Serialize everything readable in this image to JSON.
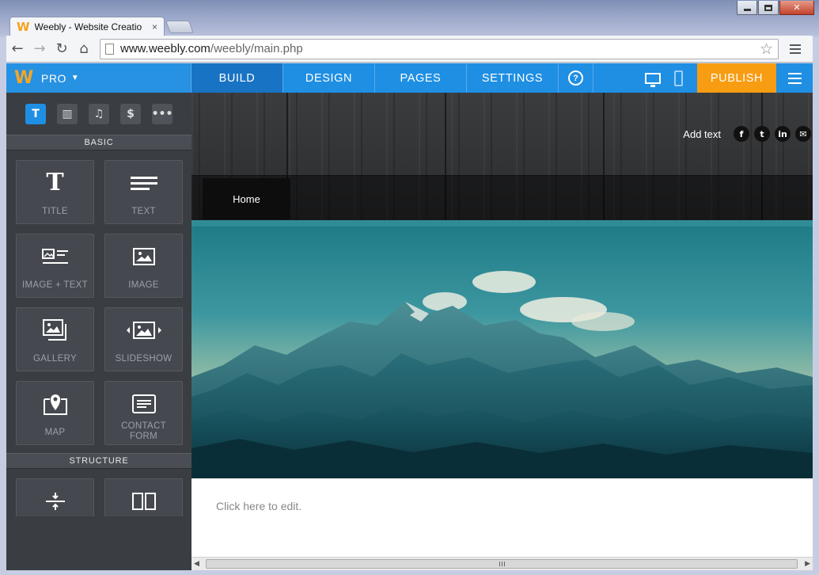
{
  "browser": {
    "tab_title": "Weebly - Website Creatio",
    "tab_favicon": "W",
    "tab_close": "×",
    "url_host": "www.weebly.com",
    "url_path": "/weebly/main.php"
  },
  "app": {
    "brand_logo": "W",
    "brand_label": "PRO",
    "tabs": [
      {
        "label": "BUILD"
      },
      {
        "label": "DESIGN"
      },
      {
        "label": "PAGES"
      },
      {
        "label": "SETTINGS"
      }
    ],
    "help": "?",
    "publish": "PUBLISH"
  },
  "sidebar": {
    "categories": [
      {
        "name": "text",
        "glyph": "T"
      },
      {
        "name": "layout",
        "glyph": "▥"
      },
      {
        "name": "media",
        "glyph": "♫"
      },
      {
        "name": "commerce",
        "glyph": "$"
      },
      {
        "name": "more",
        "glyph": "•••"
      }
    ],
    "basic_label": "BASIC",
    "elements": [
      {
        "label": "TITLE",
        "icon": "title-icon"
      },
      {
        "label": "TEXT",
        "icon": "text-icon"
      },
      {
        "label": "IMAGE + TEXT",
        "icon": "image-text-icon"
      },
      {
        "label": "IMAGE",
        "icon": "image-icon"
      },
      {
        "label": "GALLERY",
        "icon": "gallery-icon"
      },
      {
        "label": "SLIDESHOW",
        "icon": "slideshow-icon"
      },
      {
        "label": "MAP",
        "icon": "map-pin-icon"
      },
      {
        "label": "CONTACT FORM",
        "icon": "contact-form-icon"
      }
    ],
    "structure_label": "STRUCTURE"
  },
  "site": {
    "add_text": "Add text",
    "social": [
      {
        "name": "facebook",
        "glyph": "f"
      },
      {
        "name": "twitter",
        "glyph": "t"
      },
      {
        "name": "linkedin",
        "glyph": "in"
      },
      {
        "name": "email",
        "glyph": "✉"
      }
    ],
    "nav_home": "Home",
    "content_placeholder": "Click here to edit."
  },
  "colors": {
    "accent_blue": "#1f8fe3",
    "publish_orange": "#f89c12",
    "sidebar_dark": "#3a3d42",
    "teal_rule": "#2f8c96"
  }
}
